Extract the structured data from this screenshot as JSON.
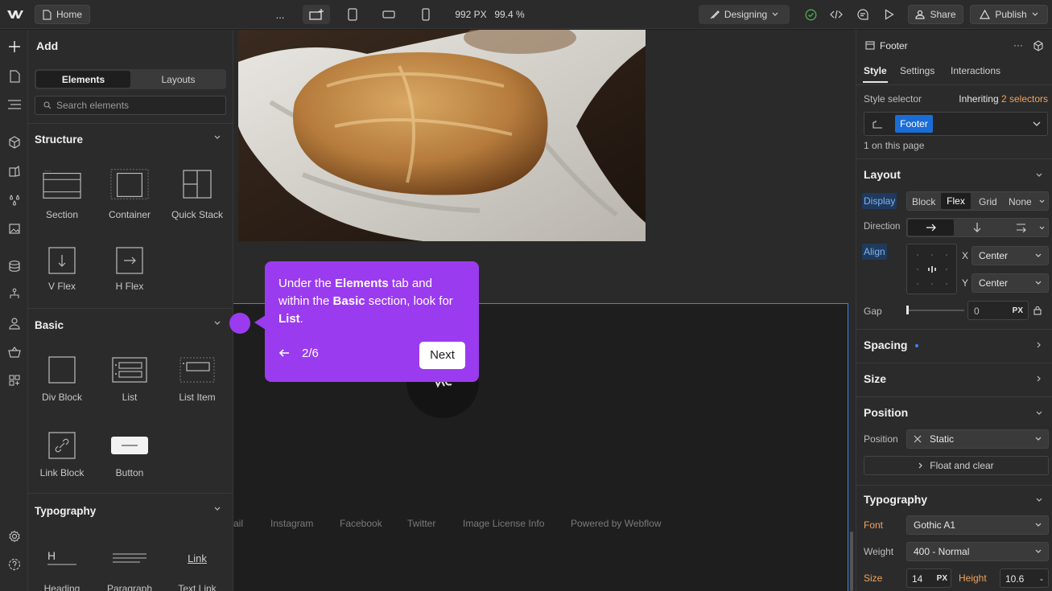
{
  "topbar": {
    "home_label": "Home",
    "more": "...",
    "width_readout": "992 PX",
    "zoom_readout": "99.4 %",
    "mode_label": "Designing",
    "share_label": "Share",
    "publish_label": "Publish"
  },
  "add_panel": {
    "title": "Add",
    "tabs": [
      "Elements",
      "Layouts"
    ],
    "search_placeholder": "Search elements",
    "sections": {
      "structure": "Structure",
      "basic": "Basic",
      "typography": "Typography"
    },
    "structure_items": [
      "Section",
      "Container",
      "Quick Stack",
      "V Flex",
      "H Flex"
    ],
    "basic_items": [
      "Div Block",
      "List",
      "List Item",
      "Link Block",
      "Button"
    ],
    "typography_items": [
      "Heading",
      "Paragraph",
      "Text Link"
    ],
    "typography_glyphs": {
      "heading": "H",
      "text_link": "Link"
    }
  },
  "canvas": {
    "footer_links": [
      "ail",
      "Instagram",
      "Facebook",
      "Twitter",
      "Image License Info",
      "Powered by Webflow"
    ]
  },
  "tour": {
    "text_1": "Under the ",
    "bold_1": "Elements",
    "text_2": " tab and within the ",
    "bold_2": "Basic",
    "text_3": " section, look for ",
    "bold_3": "List",
    "text_4": ".",
    "step": "2/6",
    "next_label": "Next"
  },
  "right_panel": {
    "element_name": "Footer",
    "tabs": [
      "Style",
      "Settings",
      "Interactions"
    ],
    "style_selector_label": "Style selector",
    "inheriting_label": "Inheriting",
    "inheriting_count": "2 selectors",
    "selector_chip": "Footer",
    "on_page": "1 on this page",
    "layout": {
      "title": "Layout",
      "display_label": "Display",
      "display_options": [
        "Block",
        "Flex",
        "Grid",
        "None"
      ],
      "direction_label": "Direction",
      "align_label": "Align",
      "x_label": "X",
      "x_value": "Center",
      "y_label": "Y",
      "y_value": "Center",
      "gap_label": "Gap",
      "gap_value": "0",
      "gap_unit": "PX"
    },
    "spacing_title": "Spacing",
    "size_title": "Size",
    "position": {
      "title": "Position",
      "label": "Position",
      "value": "Static",
      "float_label": "Float and clear"
    },
    "typography": {
      "title": "Typography",
      "font_label": "Font",
      "font_value": "Gothic A1",
      "weight_label": "Weight",
      "weight_value": "400 - Normal",
      "size_label": "Size",
      "size_value": "14",
      "size_unit": "PX",
      "height_label": "Height",
      "height_value": "10.6",
      "height_unit": "-"
    }
  },
  "colors": {
    "accent_blue": "#1a6dd6",
    "tour_purple": "#9b3bef",
    "orange": "#f0a35e"
  }
}
